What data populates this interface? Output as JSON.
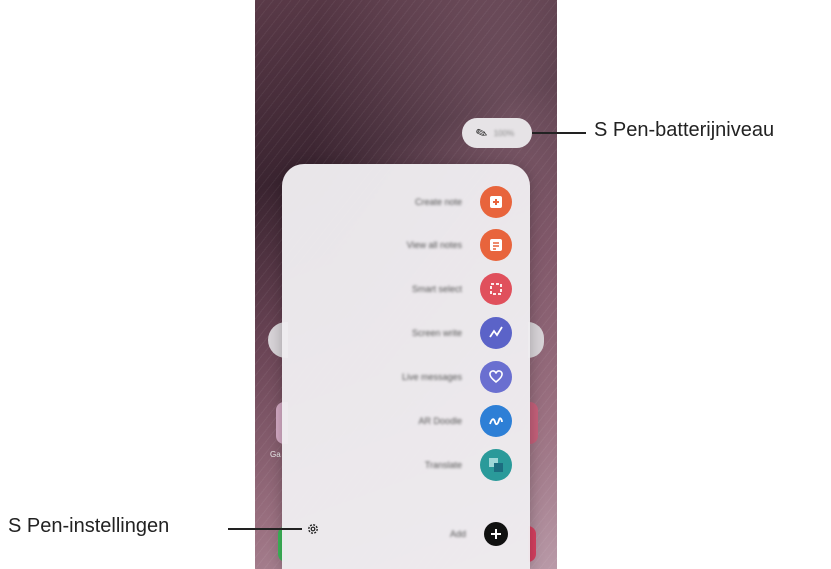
{
  "annotations": {
    "battery_label": "S Pen-batterijniveau",
    "settings_label": "S Pen-instellingen"
  },
  "battery": {
    "icon": "s-pen-icon",
    "percent": "100%"
  },
  "menu": {
    "items": [
      {
        "label": "Create note",
        "icon": "create-note-icon",
        "color": "#e8643c"
      },
      {
        "label": "View all notes",
        "icon": "view-notes-icon",
        "color": "#e8643c"
      },
      {
        "label": "Smart select",
        "icon": "smart-select-icon",
        "color": "#e0505c"
      },
      {
        "label": "Screen write",
        "icon": "screen-write-icon",
        "color": "#5b63c8"
      },
      {
        "label": "Live messages",
        "icon": "live-messages-icon",
        "color": "#6a6fd0"
      },
      {
        "label": "AR Doodle",
        "icon": "ar-doodle-icon",
        "color": "#2d7fd6"
      },
      {
        "label": "Translate",
        "icon": "translate-icon",
        "color": "#2a9a9a"
      },
      {
        "label": "Add",
        "icon": "add-icon",
        "color": "#111111"
      }
    ],
    "settings_icon": "gear-icon"
  },
  "background": {
    "app_label_left": "Ga"
  }
}
